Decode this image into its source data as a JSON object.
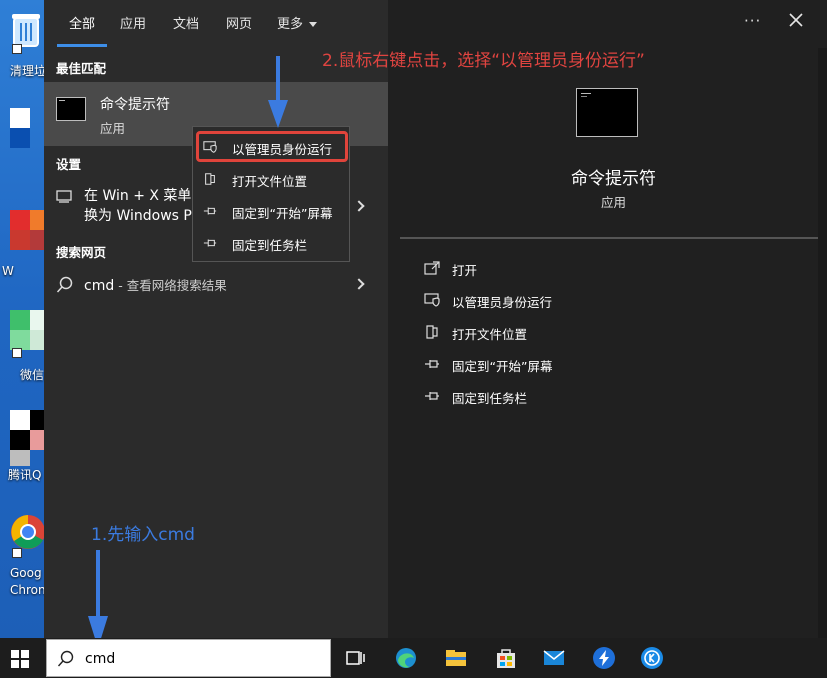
{
  "desktop": {
    "icons": [
      "清理垃",
      "W",
      "微信",
      "腾讯Q",
      "Goog",
      "Chron"
    ]
  },
  "tabs": {
    "all": "全部",
    "apps": "应用",
    "docs": "文档",
    "web": "网页",
    "more": "更多"
  },
  "sections": {
    "best_match": "最佳匹配",
    "settings": "设置",
    "web_search": "搜索网页"
  },
  "best_match": {
    "title": "命令提示符",
    "subtitle": "应用"
  },
  "setting_item": {
    "text": "在 Win + X 菜单中\n换为 Windows P"
  },
  "web_item": {
    "query": "cmd",
    "suffix": " - 查看网络搜索结果"
  },
  "context_menu": {
    "items": [
      "以管理员身份运行",
      "打开文件位置",
      "固定到“开始”屏幕",
      "固定到任务栏"
    ]
  },
  "preview": {
    "title": "命令提示符",
    "subtitle": "应用",
    "actions": [
      "打开",
      "以管理员身份运行",
      "打开文件位置",
      "固定到“开始”屏幕",
      "固定到任务栏"
    ]
  },
  "annotations": {
    "step1": "1.先输入cmd",
    "step2": "2.鼠标右键点击，选择“以管理员身份运行”",
    "color_step1": "#3b7be0",
    "color_step2": "#e04440"
  },
  "taskbar": {
    "search_value": "cmd",
    "icons": [
      "task-view-icon",
      "edge-icon",
      "file-explorer-icon",
      "store-icon",
      "mail-icon",
      "app-arrow-icon",
      "k-app-icon"
    ]
  },
  "colors": {
    "accent": "#3d8ee8",
    "highlight_border": "#e0443b",
    "menu_bg": "#202020",
    "left_pane_bg": "#2b2b2b",
    "selected_bg": "#4a4a4a"
  }
}
